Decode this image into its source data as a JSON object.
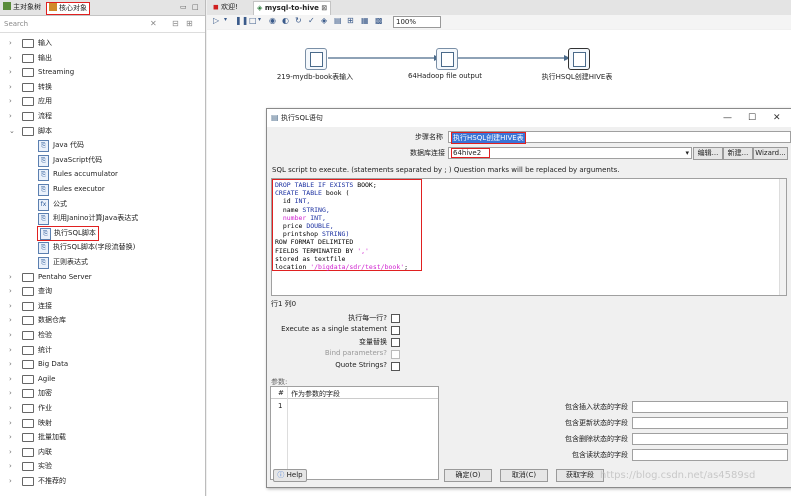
{
  "left_panel": {
    "tabs": [
      "主对象树",
      "核心对象"
    ],
    "search_placeholder": "Search",
    "tree": [
      {
        "label": "输入",
        "expanded": false
      },
      {
        "label": "输出",
        "expanded": false
      },
      {
        "label": "Streaming",
        "expanded": false
      },
      {
        "label": "转换",
        "expanded": false
      },
      {
        "label": "应用",
        "expanded": false
      },
      {
        "label": "流程",
        "expanded": false
      },
      {
        "label": "脚本",
        "expanded": true
      }
    ],
    "script_children": [
      "Java 代码",
      "JavaScript代码",
      "Rules accumulator",
      "Rules executor",
      "公式",
      "利用Janino计算Java表达式",
      "执行SQL脚本",
      "执行SQL脚本(字段流替换)",
      "正则表达式"
    ],
    "tree_after": [
      "Pentaho Server",
      "查询",
      "连接",
      "数据仓库",
      "检验",
      "统计",
      "Big Data",
      "Agile",
      "加密",
      "作业",
      "映射",
      "批量加载",
      "内联",
      "实验",
      "不推荐的"
    ]
  },
  "editor": {
    "tabs": [
      "欢迎!",
      "mysql-to-hive"
    ],
    "zoom": "100%",
    "nodes": [
      {
        "label": "219-mydb-book表输入"
      },
      {
        "label": "64Hadoop file output"
      },
      {
        "label": "执行HSQL创建HIVE表"
      }
    ]
  },
  "dialog": {
    "title": "执行SQL语句",
    "step_name_label": "步骤名称",
    "step_name_value": "执行HSQL创建HIVE表",
    "connection_label": "数据库连接",
    "connection_value": "64hive2",
    "buttons_conn": [
      "编辑...",
      "新建...",
      "Wizard..."
    ],
    "sql_hint": "SQL script to execute. (statements separated by ; ) Question marks will be replaced by arguments.",
    "sql_lines": [
      [
        {
          "t": "DROP TABLE IF EXISTS ",
          "c": "kw"
        },
        {
          "t": "BOOK;",
          "c": "bl"
        }
      ],
      [
        {
          "t": "CREATE TABLE ",
          "c": "kw"
        },
        {
          "t": "book (",
          "c": "bl"
        }
      ],
      [
        {
          "t": "  id ",
          "c": "bl"
        },
        {
          "t": "INT,",
          "c": "ty"
        }
      ],
      [
        {
          "t": "  name ",
          "c": "bl"
        },
        {
          "t": "STRING,",
          "c": "ty"
        }
      ],
      [
        {
          "t": "  number ",
          "c": "st"
        },
        {
          "t": "INT,",
          "c": "ty"
        }
      ],
      [
        {
          "t": "  price ",
          "c": "bl"
        },
        {
          "t": "DOUBLE,",
          "c": "ty"
        }
      ],
      [
        {
          "t": "  printshop ",
          "c": "bl"
        },
        {
          "t": "STRING)",
          "c": "ty"
        }
      ],
      [
        {
          "t": "ROW FORMAT DELIMITED",
          "c": "bl"
        }
      ],
      [
        {
          "t": "FIELDS TERMINATED BY ",
          "c": "bl"
        },
        {
          "t": "','",
          "c": "st"
        }
      ],
      [
        {
          "t": "stored as textfile",
          "c": "bl"
        }
      ],
      [
        {
          "t": "location ",
          "c": "bl"
        },
        {
          "t": "'/bigdata/sdr/test/book'",
          "c": "st"
        },
        {
          "t": ";",
          "c": "bl"
        }
      ]
    ],
    "cursor_pos": "行1 列0",
    "options": [
      {
        "label": "执行每一行?",
        "checked": false,
        "disabled": false
      },
      {
        "label": "Execute as a single statement",
        "checked": false,
        "disabled": false
      },
      {
        "label": "变量替换",
        "checked": false,
        "disabled": false
      },
      {
        "label": "Bind parameters?",
        "checked": false,
        "disabled": true
      },
      {
        "label": "Quote Strings?",
        "checked": false,
        "disabled": false
      }
    ],
    "params_label": "参数:",
    "params_cols": [
      "#",
      "作为参数的字段"
    ],
    "params_rows": [
      "1"
    ],
    "status_fields": [
      "包含插入状态的字段",
      "包含更新状态的字段",
      "包含删除状态的字段",
      "包含读状态的字段"
    ],
    "help": "Help",
    "ok": "确定(O)",
    "cancel": "取消(C)",
    "getfields": "获取字段"
  },
  "watermark": "https://blog.csdn.net/as4589sd"
}
